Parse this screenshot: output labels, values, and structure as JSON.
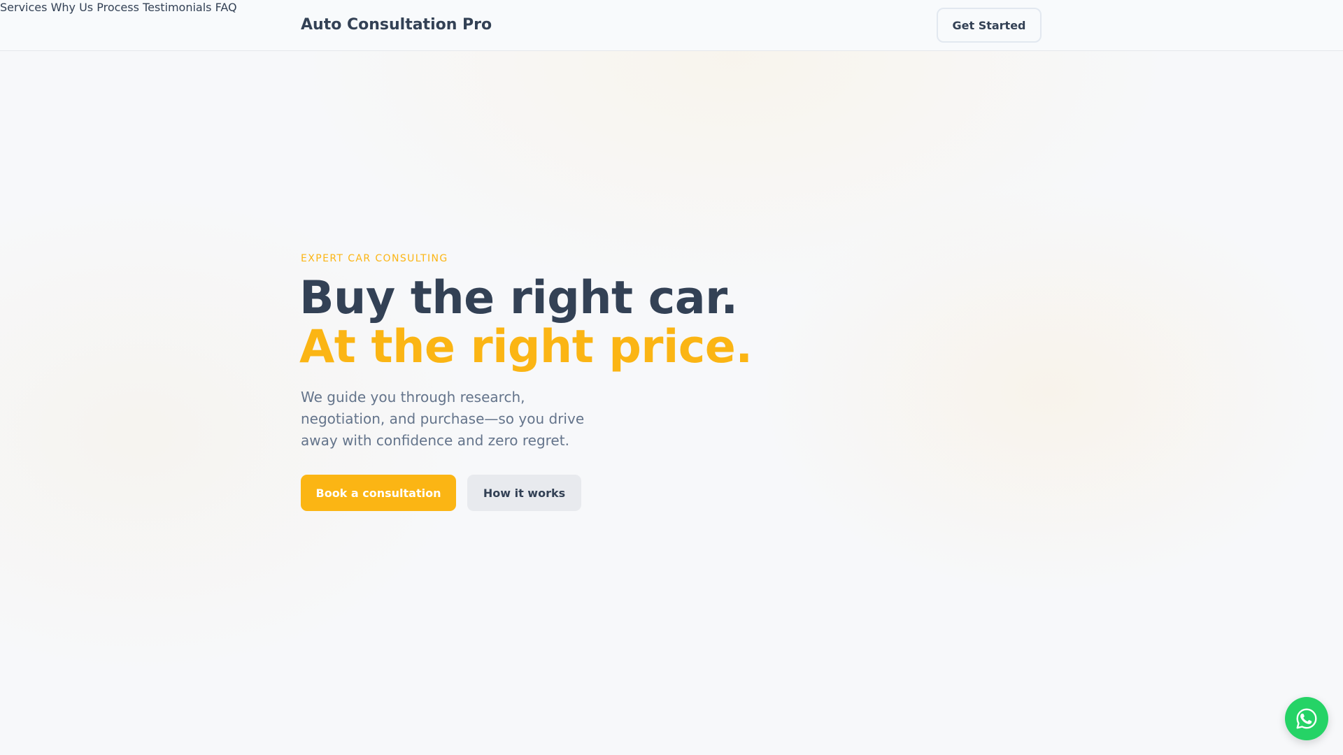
{
  "header": {
    "brand": "Auto Consultation Pro",
    "nav": [
      "Services",
      "Why Us",
      "Process",
      "Testimonials",
      "FAQ"
    ],
    "cta_label": "Get Started"
  },
  "hero": {
    "eyebrow": "EXPERT CAR CONSULTING",
    "title_line1": "Buy the right car.",
    "title_line2": "At the right price.",
    "lead": "We guide you through research, negotiation, and purchase—so you drive away with confidence and zero regret.",
    "primary_button": "Book a consultation",
    "secondary_button": "How it works"
  },
  "floating": {
    "icon": "whatsapp-icon"
  },
  "colors": {
    "accent": "#fbb514",
    "text_dark": "#334155",
    "text_muted": "#64748b",
    "whatsapp": "#25d366"
  }
}
